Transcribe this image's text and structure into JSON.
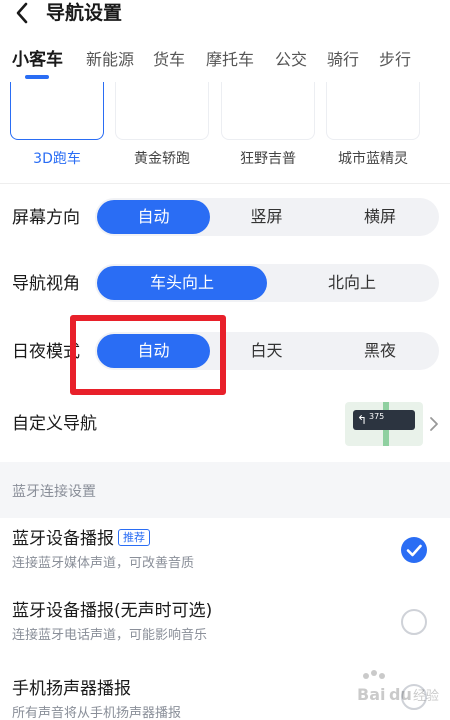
{
  "header": {
    "title": "导航设置",
    "back_icon": "chevron-left-icon"
  },
  "tabs": [
    {
      "label": "小客车",
      "active": true
    },
    {
      "label": "新能源",
      "active": false
    },
    {
      "label": "货车",
      "active": false
    },
    {
      "label": "摩托车",
      "active": false
    },
    {
      "label": "公交",
      "active": false
    },
    {
      "label": "骑行",
      "active": false
    },
    {
      "label": "步行",
      "active": false
    }
  ],
  "presets": [
    {
      "label": "3D跑车",
      "selected": true
    },
    {
      "label": "黄金轿跑",
      "selected": false
    },
    {
      "label": "狂野吉普",
      "selected": false
    },
    {
      "label": "城市蓝精灵",
      "selected": false
    }
  ],
  "screen_orientation": {
    "label": "屏幕方向",
    "options": [
      "自动",
      "竖屏",
      "横屏"
    ],
    "selected": "自动"
  },
  "nav_view": {
    "label": "导航视角",
    "options": [
      "车头向上",
      "北向上"
    ],
    "selected": "车头向上"
  },
  "day_night": {
    "label": "日夜模式",
    "options": [
      "自动",
      "白天",
      "黑夜"
    ],
    "selected": "自动"
  },
  "custom_nav": {
    "label": "自定义导航",
    "thumb_text": "375",
    "chevron_icon": "chevron-right-icon"
  },
  "bluetooth_section": {
    "title": "蓝牙连接设置",
    "items": [
      {
        "title": "蓝牙设备播报",
        "badge": "推荐",
        "subtitle": "连接蓝牙媒体声道，可改善音质",
        "checked": true
      },
      {
        "title": "蓝牙设备播报(无声时可选)",
        "badge": "",
        "subtitle": "连接蓝牙电话声道，可能影响音乐",
        "checked": false
      },
      {
        "title": "手机扬声器播报",
        "badge": "",
        "subtitle": "所有声音将从手机扬声器播报",
        "checked": false
      }
    ]
  },
  "watermark": {
    "text": "Baidu经验"
  },
  "colors": {
    "accent": "#2a6df4",
    "highlight": "#e8202a",
    "segment_bg": "#f1f2f5",
    "muted_text": "#8a8f99"
  }
}
